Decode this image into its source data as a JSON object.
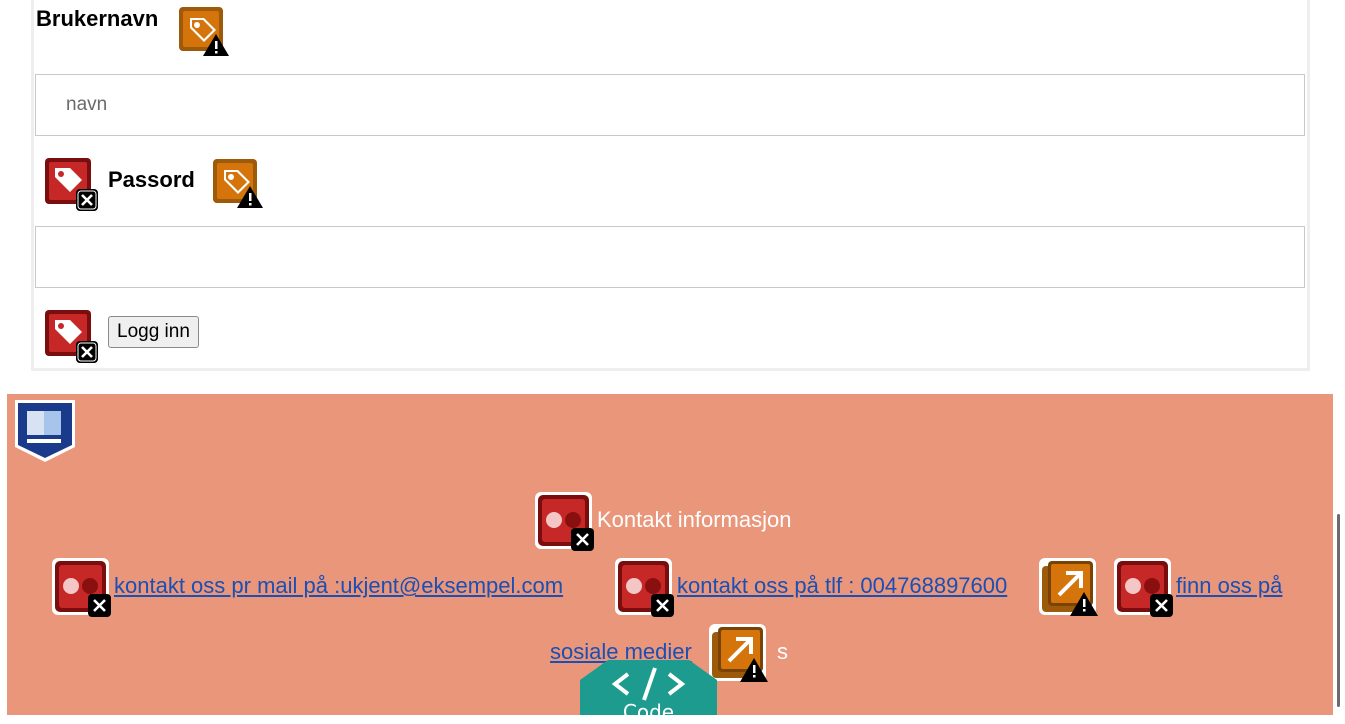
{
  "form": {
    "username_label": "Brukernavn",
    "username_placeholder": "navn",
    "username_value": "",
    "password_label": "Passord",
    "password_value": "",
    "login_button_label": "Logg inn"
  },
  "footer": {
    "heading": "Kontakt informasjon",
    "links": [
      "kontakt oss pr mail på :ukjent@eksempel.com",
      "kontakt oss på tlf : 004768897600",
      "finn oss på",
      "sosiale medier"
    ],
    "trailing_text": "s"
  },
  "code_tab": {
    "label": "Code"
  },
  "icons": {
    "alert_tag": "missing-label-alert-icon",
    "error_tag": "missing-label-error-icon",
    "error_contrast": "contrast-error-icon",
    "alert_redundant_link": "redundant-link-alert-icon",
    "structure": "footer-region-icon"
  },
  "colors": {
    "footer_bg": "#e9967a",
    "link": "#1a4fb5",
    "error_red": "#b71c1c",
    "alert_orange": "#d4740a",
    "code_tab": "#1e9b8f"
  }
}
